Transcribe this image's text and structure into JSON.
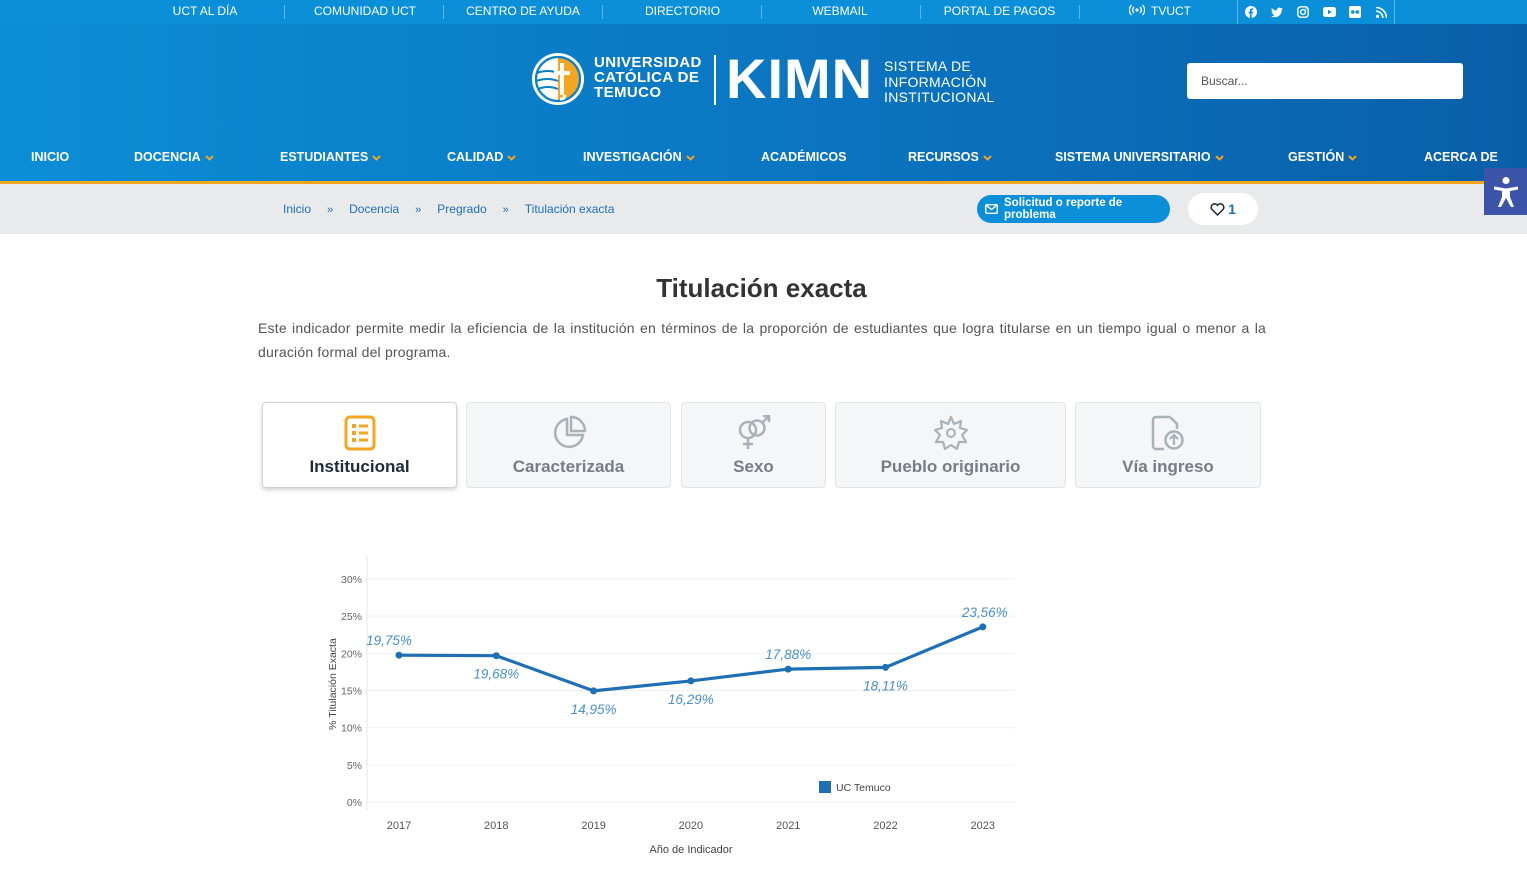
{
  "topbar": {
    "links": [
      "UCT AL DÍA",
      "COMUNIDAD UCT",
      "CENTRO DE AYUDA",
      "DIRECTORIO",
      "WEBMAIL",
      "PORTAL DE PAGOS",
      "TVUCT"
    ],
    "social_icons": [
      "facebook-icon",
      "twitter-icon",
      "instagram-icon",
      "youtube-icon",
      "flickr-icon",
      "rss-icon"
    ]
  },
  "header": {
    "uct_line1": "UNIVERSIDAD",
    "uct_line2": "CATÓLICA DE",
    "uct_line3": "TEMUCO",
    "kimn": "KIMN",
    "sis_line1": "SISTEMA DE",
    "sis_line2": "INFORMACIÓN",
    "sis_line3": "INSTITUCIONAL",
    "search_placeholder": "Buscar..."
  },
  "nav": {
    "items": [
      {
        "label": "INICIO",
        "dropdown": false
      },
      {
        "label": "DOCENCIA",
        "dropdown": true
      },
      {
        "label": "ESTUDIANTES",
        "dropdown": true
      },
      {
        "label": "CALIDAD",
        "dropdown": true
      },
      {
        "label": "INVESTIGACIÓN",
        "dropdown": true
      },
      {
        "label": "ACADÉMICOS",
        "dropdown": false
      },
      {
        "label": "RECURSOS",
        "dropdown": true
      },
      {
        "label": "SISTEMA UNIVERSITARIO",
        "dropdown": true
      },
      {
        "label": "GESTIÓN",
        "dropdown": true
      },
      {
        "label": "ACERCA DE",
        "dropdown": false
      }
    ]
  },
  "breadcrumb": {
    "items": [
      "Inicio",
      "Docencia",
      "Pregrado",
      "Titulación exacta"
    ],
    "separator": "»"
  },
  "report_button": "Solicitud o reporte de problema",
  "favorites_count": "1",
  "page": {
    "title": "Titulación exacta",
    "description": "Este indicador permite medir la eficiencia de la institución en términos de la proporción de estudiantes que logra titularse en un tiempo igual o menor a la duración formal del programa."
  },
  "tabs": [
    {
      "label": "Institucional",
      "icon": "list-icon",
      "active": true
    },
    {
      "label": "Caracterizada",
      "icon": "pie-chart-icon",
      "active": false
    },
    {
      "label": "Sexo",
      "icon": "gender-icon",
      "active": false
    },
    {
      "label": "Pueblo originario",
      "icon": "flower-icon",
      "active": false
    },
    {
      "label": "Vía ingreso",
      "icon": "document-upload-icon",
      "active": false
    }
  ],
  "colors": {
    "topbar": "#0a8fd8",
    "accent_gold": "#f4a622",
    "series": "#1f6fb5",
    "label": "#4a90c8"
  },
  "chart_data": {
    "type": "line",
    "title": "",
    "x": [
      "2017",
      "2018",
      "2019",
      "2020",
      "2021",
      "2022",
      "2023"
    ],
    "series": [
      {
        "name": "UC Temuco",
        "values": [
          19.75,
          19.68,
          14.95,
          16.29,
          17.88,
          18.11,
          23.56
        ]
      }
    ],
    "data_labels": [
      "19,75%",
      "19,68%",
      "14,95%",
      "16,29%",
      "17,88%",
      "18,11%",
      "23,56%"
    ],
    "xlabel": "Año de Indicador",
    "ylabel": "% Titulación Exacta",
    "yticks": [
      "0%",
      "5%",
      "10%",
      "15%",
      "20%",
      "25%",
      "30%"
    ],
    "ylim": [
      0,
      30
    ],
    "grid": true,
    "legend": "bottom-right"
  }
}
